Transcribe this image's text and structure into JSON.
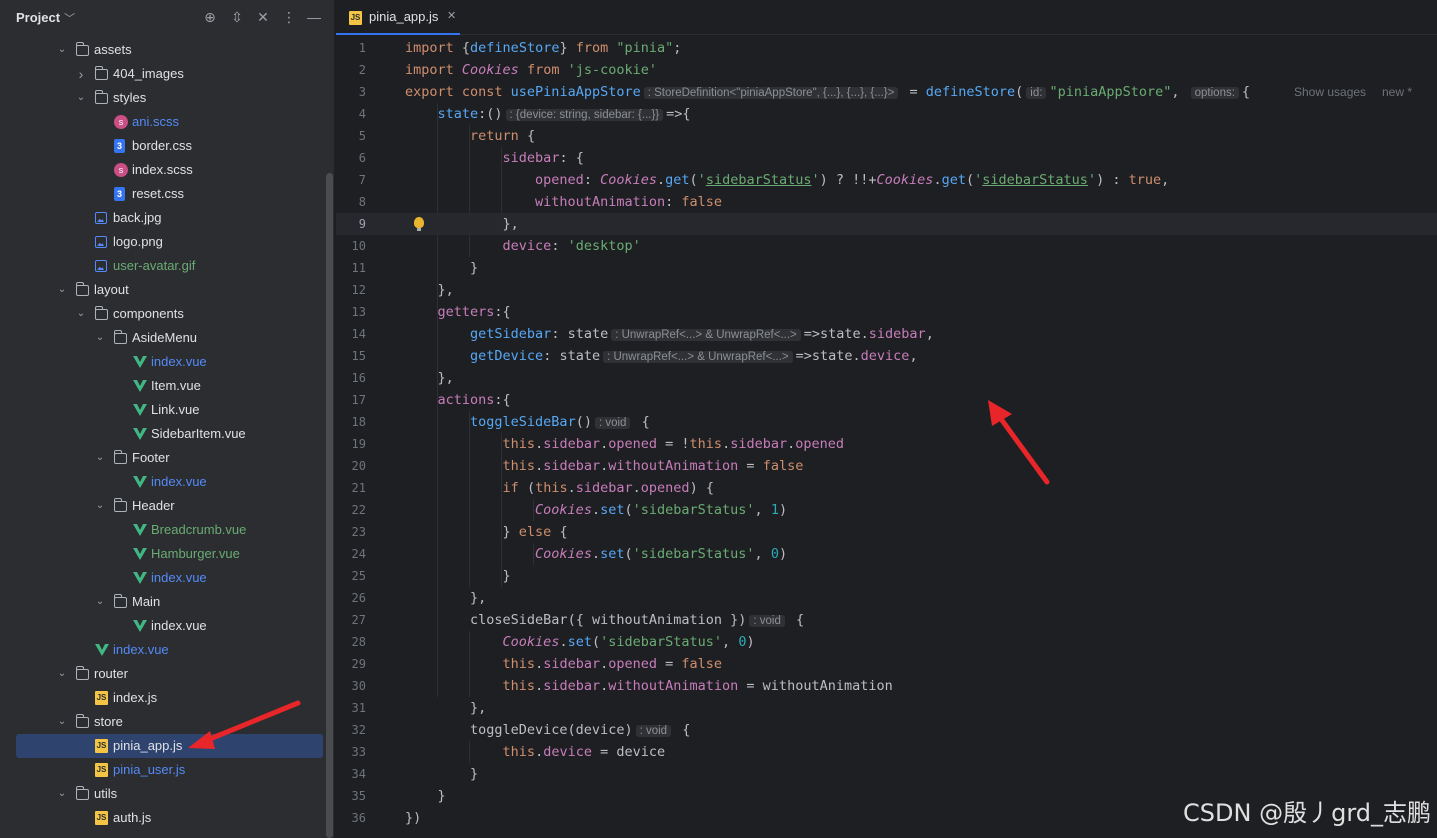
{
  "sidebar": {
    "title": "Project",
    "tree": [
      {
        "label": "assets",
        "type": "folder",
        "depth": 0,
        "expanded": true,
        "color": "#dfe1e5"
      },
      {
        "label": "404_images",
        "type": "folder",
        "depth": 1,
        "expanded": false,
        "color": "#dfe1e5"
      },
      {
        "label": "styles",
        "type": "folder",
        "depth": 1,
        "expanded": true,
        "color": "#dfe1e5"
      },
      {
        "label": "ani.scss",
        "type": "scss",
        "depth": 2,
        "color": "#548af7"
      },
      {
        "label": "border.css",
        "type": "css",
        "depth": 2,
        "color": "#dfe1e5"
      },
      {
        "label": "index.scss",
        "type": "scss",
        "depth": 2,
        "color": "#dfe1e5"
      },
      {
        "label": "reset.css",
        "type": "css",
        "depth": 2,
        "color": "#dfe1e5"
      },
      {
        "label": "back.jpg",
        "type": "image",
        "depth": 1,
        "color": "#dfe1e5"
      },
      {
        "label": "logo.png",
        "type": "image",
        "depth": 1,
        "color": "#dfe1e5"
      },
      {
        "label": "user-avatar.gif",
        "type": "image",
        "depth": 1,
        "color": "#6aab73"
      },
      {
        "label": "layout",
        "type": "folder",
        "depth": 0,
        "expanded": true,
        "color": "#dfe1e5"
      },
      {
        "label": "components",
        "type": "folder",
        "depth": 1,
        "expanded": true,
        "color": "#dfe1e5"
      },
      {
        "label": "AsideMenu",
        "type": "folder",
        "depth": 2,
        "expanded": true,
        "color": "#dfe1e5"
      },
      {
        "label": "index.vue",
        "type": "vue",
        "depth": 3,
        "color": "#548af7"
      },
      {
        "label": "Item.vue",
        "type": "vue",
        "depth": 3,
        "color": "#dfe1e5"
      },
      {
        "label": "Link.vue",
        "type": "vue",
        "depth": 3,
        "color": "#dfe1e5"
      },
      {
        "label": "SidebarItem.vue",
        "type": "vue",
        "depth": 3,
        "color": "#dfe1e5"
      },
      {
        "label": "Footer",
        "type": "folder",
        "depth": 2,
        "expanded": true,
        "color": "#dfe1e5"
      },
      {
        "label": "index.vue",
        "type": "vue",
        "depth": 3,
        "color": "#548af7"
      },
      {
        "label": "Header",
        "type": "folder",
        "depth": 2,
        "expanded": true,
        "color": "#dfe1e5"
      },
      {
        "label": "Breadcrumb.vue",
        "type": "vue",
        "depth": 3,
        "color": "#6aab73"
      },
      {
        "label": "Hamburger.vue",
        "type": "vue",
        "depth": 3,
        "color": "#6aab73"
      },
      {
        "label": "index.vue",
        "type": "vue",
        "depth": 3,
        "color": "#548af7"
      },
      {
        "label": "Main",
        "type": "folder",
        "depth": 2,
        "expanded": true,
        "color": "#dfe1e5"
      },
      {
        "label": "index.vue",
        "type": "vue",
        "depth": 3,
        "color": "#dfe1e5"
      },
      {
        "label": "index.vue",
        "type": "vue",
        "depth": 1,
        "color": "#548af7"
      },
      {
        "label": "router",
        "type": "folder",
        "depth": 0,
        "expanded": true,
        "color": "#dfe1e5"
      },
      {
        "label": "index.js",
        "type": "js",
        "depth": 1,
        "color": "#dfe1e5"
      },
      {
        "label": "store",
        "type": "folder",
        "depth": 0,
        "expanded": true,
        "color": "#dfe1e5"
      },
      {
        "label": "pinia_app.js",
        "type": "js",
        "depth": 1,
        "selected": true,
        "color": "#dfe1e5"
      },
      {
        "label": "pinia_user.js",
        "type": "js",
        "depth": 1,
        "color": "#548af7"
      },
      {
        "label": "utils",
        "type": "folder",
        "depth": 0,
        "expanded": true,
        "color": "#dfe1e5"
      },
      {
        "label": "auth.js",
        "type": "js",
        "depth": 1,
        "color": "#dfe1e5"
      }
    ]
  },
  "editor": {
    "tab_label": "pinia_app.js",
    "current_line": 9,
    "right_hints": [
      "Show usages",
      "new *"
    ],
    "lines": [
      [
        [
          "kw",
          "import "
        ],
        [
          "plain",
          "{"
        ],
        [
          "fn",
          "defineStore"
        ],
        [
          "plain",
          "} "
        ],
        [
          "kw",
          "from "
        ],
        [
          "str",
          "\"pinia\""
        ],
        [
          "plain",
          ";"
        ]
      ],
      [
        [
          "kw",
          "import "
        ],
        [
          "cls",
          "Cookies "
        ],
        [
          "kw",
          "from "
        ],
        [
          "str",
          "'js-cookie'"
        ]
      ],
      [
        [
          "kw",
          "export const "
        ],
        [
          "fn",
          "usePiniaAppStore"
        ],
        [
          "hint",
          ": StoreDefinition<\"piniaAppStore\", {...}, {...}, {...}>"
        ],
        [
          "plain",
          " = "
        ],
        [
          "fn",
          "defineStore"
        ],
        [
          "plain",
          "("
        ],
        [
          "hint",
          "id:"
        ],
        [
          "str",
          "\"piniaAppStore\""
        ],
        [
          "plain",
          ", "
        ],
        [
          "hint",
          "options:"
        ],
        [
          "plain",
          "{"
        ]
      ],
      [
        [
          "plain",
          "    "
        ],
        [
          "fn",
          "state"
        ],
        [
          "plain",
          ":()"
        ],
        [
          "hint",
          ": {device: string, sidebar: {...}}"
        ],
        [
          "plain",
          "=>{"
        ]
      ],
      [
        [
          "plain",
          "        "
        ],
        [
          "kw",
          "return "
        ],
        [
          "plain",
          "{"
        ]
      ],
      [
        [
          "plain",
          "            "
        ],
        [
          "prop",
          "sidebar"
        ],
        [
          "plain",
          ": {"
        ]
      ],
      [
        [
          "plain",
          "                "
        ],
        [
          "prop",
          "opened"
        ],
        [
          "plain",
          ": "
        ],
        [
          "cls",
          "Cookies"
        ],
        [
          "plain",
          "."
        ],
        [
          "fn",
          "get"
        ],
        [
          "plain",
          "("
        ],
        [
          "str",
          "'"
        ],
        [
          "str und",
          "sidebarStatus"
        ],
        [
          "str",
          "'"
        ],
        [
          "plain",
          ") ? !!+"
        ],
        [
          "cls",
          "Cookies"
        ],
        [
          "plain",
          "."
        ],
        [
          "fn",
          "get"
        ],
        [
          "plain",
          "("
        ],
        [
          "str",
          "'"
        ],
        [
          "str und",
          "sidebarStatus"
        ],
        [
          "str",
          "'"
        ],
        [
          "plain",
          ") : "
        ],
        [
          "kw",
          "true"
        ],
        [
          "plain",
          ","
        ]
      ],
      [
        [
          "plain",
          "                "
        ],
        [
          "prop",
          "withoutAnimation"
        ],
        [
          "plain",
          ": "
        ],
        [
          "kw",
          "false"
        ]
      ],
      [
        [
          "plain",
          "            },"
        ]
      ],
      [
        [
          "plain",
          "            "
        ],
        [
          "prop",
          "device"
        ],
        [
          "plain",
          ": "
        ],
        [
          "str",
          "'desktop'"
        ]
      ],
      [
        [
          "plain",
          "        }"
        ]
      ],
      [
        [
          "plain",
          "    },"
        ]
      ],
      [
        [
          "plain",
          "    "
        ],
        [
          "prop",
          "getters"
        ],
        [
          "plain",
          ":{"
        ]
      ],
      [
        [
          "plain",
          "        "
        ],
        [
          "fn",
          "getSidebar"
        ],
        [
          "plain",
          ": state"
        ],
        [
          "hint",
          ": UnwrapRef<...> & UnwrapRef<...>"
        ],
        [
          "plain",
          "=>state."
        ],
        [
          "prop",
          "sidebar"
        ],
        [
          "plain",
          ","
        ]
      ],
      [
        [
          "plain",
          "        "
        ],
        [
          "fn",
          "getDevice"
        ],
        [
          "plain",
          ": state"
        ],
        [
          "hint",
          ": UnwrapRef<...> & UnwrapRef<...>"
        ],
        [
          "plain",
          "=>state."
        ],
        [
          "prop",
          "device"
        ],
        [
          "plain",
          ","
        ]
      ],
      [
        [
          "plain",
          "    },"
        ]
      ],
      [
        [
          "plain",
          "    "
        ],
        [
          "prop",
          "actions"
        ],
        [
          "plain",
          ":{"
        ]
      ],
      [
        [
          "plain",
          "        "
        ],
        [
          "fn",
          "toggleSideBar"
        ],
        [
          "plain",
          "()"
        ],
        [
          "hint",
          ": void"
        ],
        [
          "plain",
          " {"
        ]
      ],
      [
        [
          "plain",
          "            "
        ],
        [
          "kw",
          "this"
        ],
        [
          "plain",
          "."
        ],
        [
          "prop",
          "sidebar"
        ],
        [
          "plain",
          "."
        ],
        [
          "prop",
          "opened"
        ],
        [
          "plain",
          " = !"
        ],
        [
          "kw",
          "this"
        ],
        [
          "plain",
          "."
        ],
        [
          "prop",
          "sidebar"
        ],
        [
          "plain",
          "."
        ],
        [
          "prop",
          "opened"
        ]
      ],
      [
        [
          "plain",
          "            "
        ],
        [
          "kw",
          "this"
        ],
        [
          "plain",
          "."
        ],
        [
          "prop",
          "sidebar"
        ],
        [
          "plain",
          "."
        ],
        [
          "prop",
          "withoutAnimation"
        ],
        [
          "plain",
          " = "
        ],
        [
          "kw",
          "false"
        ]
      ],
      [
        [
          "plain",
          "            "
        ],
        [
          "kw",
          "if "
        ],
        [
          "plain",
          "("
        ],
        [
          "kw",
          "this"
        ],
        [
          "plain",
          "."
        ],
        [
          "prop",
          "sidebar"
        ],
        [
          "plain",
          "."
        ],
        [
          "prop",
          "opened"
        ],
        [
          "plain",
          ") {"
        ]
      ],
      [
        [
          "plain",
          "                "
        ],
        [
          "cls",
          "Cookies"
        ],
        [
          "plain",
          "."
        ],
        [
          "fn",
          "set"
        ],
        [
          "plain",
          "("
        ],
        [
          "str",
          "'sidebarStatus'"
        ],
        [
          "plain",
          ", "
        ],
        [
          "num",
          "1"
        ],
        [
          "plain",
          ")"
        ]
      ],
      [
        [
          "plain",
          "            } "
        ],
        [
          "kw",
          "else "
        ],
        [
          "plain",
          "{"
        ]
      ],
      [
        [
          "plain",
          "                "
        ],
        [
          "cls",
          "Cookies"
        ],
        [
          "plain",
          "."
        ],
        [
          "fn",
          "set"
        ],
        [
          "plain",
          "("
        ],
        [
          "str",
          "'sidebarStatus'"
        ],
        [
          "plain",
          ", "
        ],
        [
          "num",
          "0"
        ],
        [
          "plain",
          ")"
        ]
      ],
      [
        [
          "plain",
          "            }"
        ]
      ],
      [
        [
          "plain",
          "        },"
        ]
      ],
      [
        [
          "plain",
          "        "
        ],
        [
          "plain",
          "closeSideBar({ withoutAnimation })"
        ],
        [
          "hint",
          ": void"
        ],
        [
          "plain",
          " {"
        ]
      ],
      [
        [
          "plain",
          "            "
        ],
        [
          "cls",
          "Cookies"
        ],
        [
          "plain",
          "."
        ],
        [
          "fn",
          "set"
        ],
        [
          "plain",
          "("
        ],
        [
          "str",
          "'sidebarStatus'"
        ],
        [
          "plain",
          ", "
        ],
        [
          "num",
          "0"
        ],
        [
          "plain",
          ")"
        ]
      ],
      [
        [
          "plain",
          "            "
        ],
        [
          "kw",
          "this"
        ],
        [
          "plain",
          "."
        ],
        [
          "prop",
          "sidebar"
        ],
        [
          "plain",
          "."
        ],
        [
          "prop",
          "opened"
        ],
        [
          "plain",
          " = "
        ],
        [
          "kw",
          "false"
        ]
      ],
      [
        [
          "plain",
          "            "
        ],
        [
          "kw",
          "this"
        ],
        [
          "plain",
          "."
        ],
        [
          "prop",
          "sidebar"
        ],
        [
          "plain",
          "."
        ],
        [
          "prop",
          "withoutAnimation"
        ],
        [
          "plain",
          " = withoutAnimation"
        ]
      ],
      [
        [
          "plain",
          "        },"
        ]
      ],
      [
        [
          "plain",
          "        toggleDevice(device)"
        ],
        [
          "hint",
          ": void"
        ],
        [
          "plain",
          " {"
        ]
      ],
      [
        [
          "plain",
          "            "
        ],
        [
          "kw",
          "this"
        ],
        [
          "plain",
          "."
        ],
        [
          "prop",
          "device"
        ],
        [
          "plain",
          " = device"
        ]
      ],
      [
        [
          "plain",
          "        }"
        ]
      ],
      [
        [
          "plain",
          "    }"
        ]
      ],
      [
        [
          "plain",
          "})"
        ]
      ]
    ]
  },
  "watermark": "CSDN @殷丿grd_志鹏"
}
